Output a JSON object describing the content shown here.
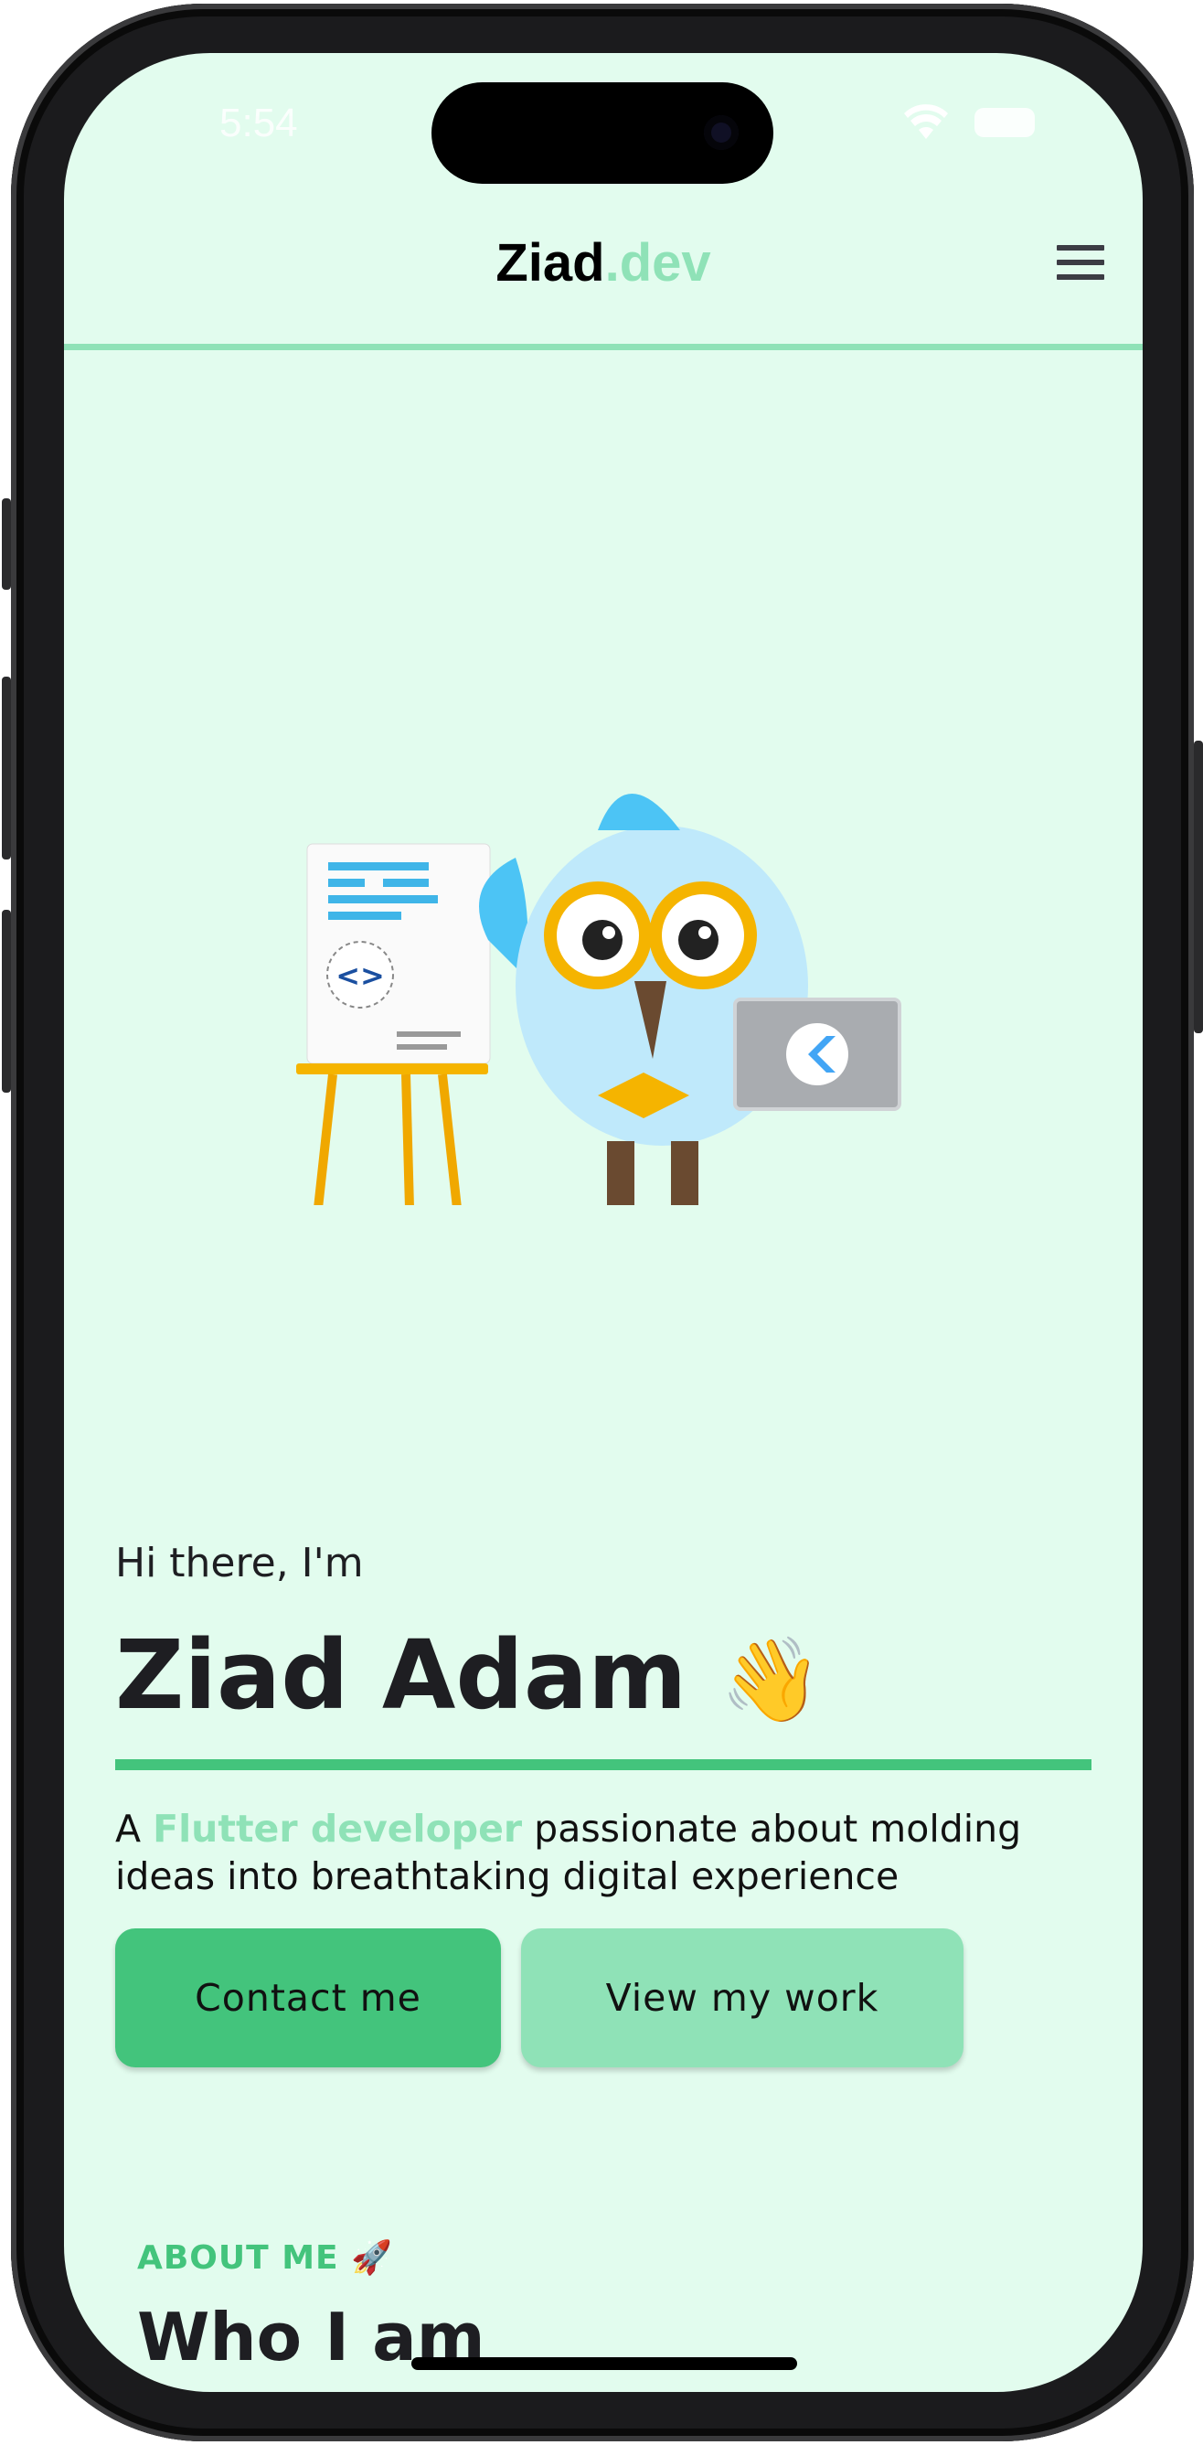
{
  "status_bar": {
    "time": "5:54"
  },
  "header": {
    "brand_main": "Ziad",
    "brand_accent": ".dev",
    "menu_icon": "hamburger-menu-icon"
  },
  "hero": {
    "greeting": "Hi there, I'm",
    "name": "Ziad Adam",
    "name_emoji": "👋",
    "description_prefix": "A ",
    "description_highlight": "Flutter developer",
    "description_rest": " passionate about molding ideas into breathtaking digital experience",
    "contact_button": "Contact me",
    "work_button": "View my work",
    "github_icon": "github-icon"
  },
  "about": {
    "eyebrow": "ABOUT ME",
    "eyebrow_emoji": "🚀",
    "title": "Who I am"
  },
  "colors": {
    "background": "#e2fcee",
    "accent": "#43c47c",
    "accent_light": "#8fe2b7",
    "text": "#1e1e22"
  }
}
